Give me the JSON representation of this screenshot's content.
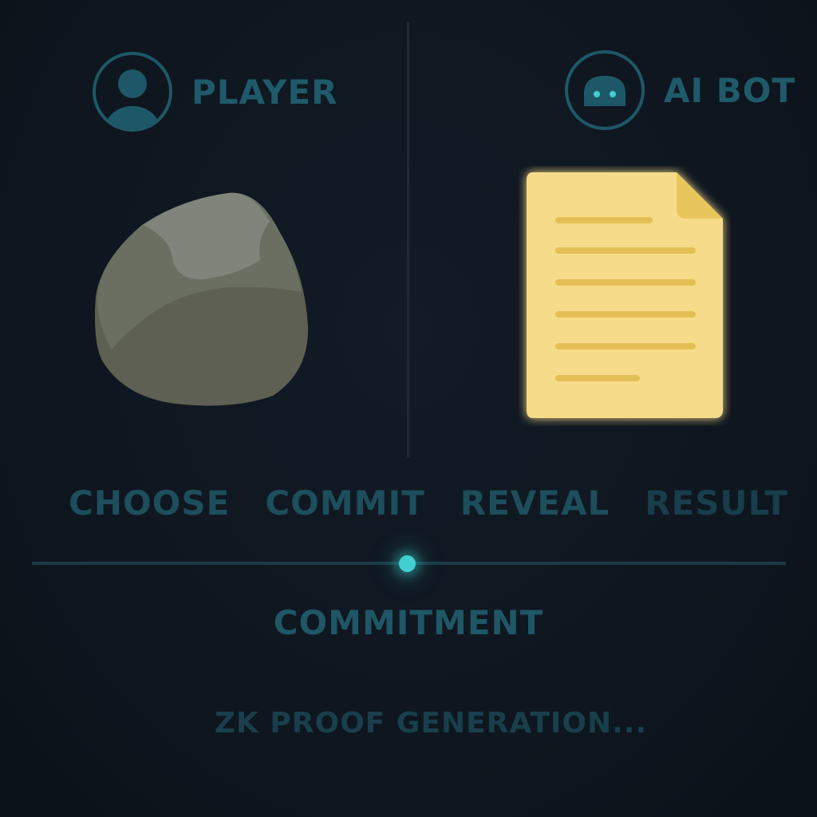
{
  "player": {
    "label": "PLAYER",
    "choice": "rock",
    "avatar_icon": "user-icon"
  },
  "bot": {
    "label": "AI BOT",
    "choice": "paper",
    "avatar_icon": "robot-icon"
  },
  "steps": [
    {
      "label": "CHOOSE"
    },
    {
      "label": "COMMIT"
    },
    {
      "label": "REVEAL"
    },
    {
      "label": "RESULT"
    }
  ],
  "timeline": {
    "current_stage": "COMMITMENT",
    "progress": 0.5
  },
  "status": "ZK PROOF GENERATION...",
  "colors": {
    "background": "#0f1620",
    "accent": "#3fd0cf",
    "text": "#1f5a6a",
    "paper": "#f6dc8a",
    "rock": "#6b6e61"
  }
}
